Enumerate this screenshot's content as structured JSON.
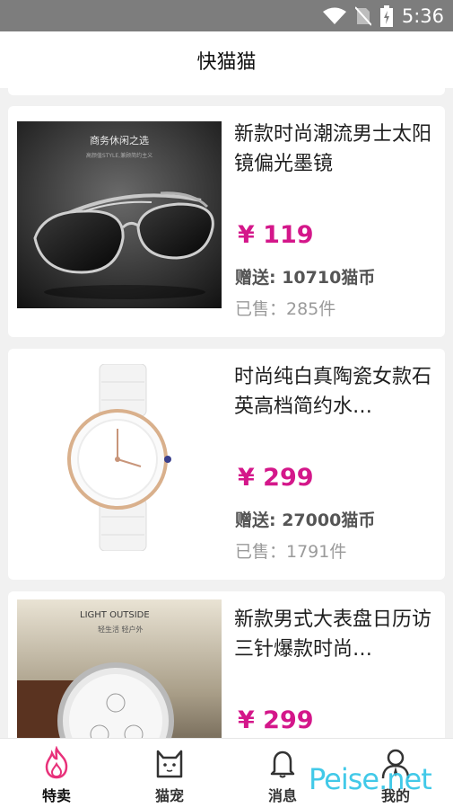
{
  "status_bar": {
    "time": "5:36"
  },
  "header": {
    "title": "快猫猫"
  },
  "products": [
    {
      "name": "新款时尚潮流男士太阳镜偏光墨镜",
      "price": "¥ 119",
      "gift": "赠送: 10710猫币",
      "sold": "已售：285件",
      "image_caption": "商务休闲之选",
      "image_subcaption": "高颜值STYLE,兼顾简约主义"
    },
    {
      "name": "时尚纯白真陶瓷女款石英高档简约水…",
      "price": "¥ 299",
      "gift": "赠送: 27000猫币",
      "sold": "已售：1791件"
    },
    {
      "name": "新款男式大表盘日历访三针爆款时尚…",
      "price": "¥ 299",
      "gift": "",
      "sold": "",
      "image_caption": "LIGHT OUTSIDE",
      "image_subcaption": "轻生活 轻户外"
    }
  ],
  "tabs": [
    {
      "label": "特卖",
      "icon": "flame-icon",
      "active": true
    },
    {
      "label": "猫宠",
      "icon": "cat-icon",
      "active": false
    },
    {
      "label": "消息",
      "icon": "bell-icon",
      "active": false
    },
    {
      "label": "我的",
      "icon": "user-icon",
      "active": false
    }
  ],
  "colors": {
    "price": "#d4178a",
    "active_tab": "#e8317a",
    "status_bar": "#7d7d7d"
  },
  "watermark": "Peise.net"
}
